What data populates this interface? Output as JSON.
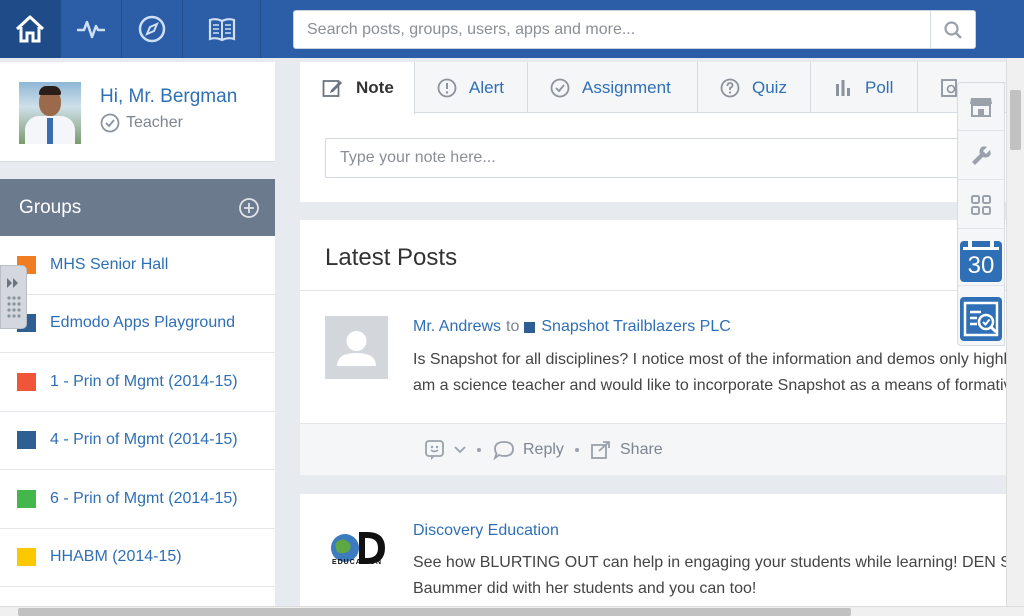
{
  "topbar": {
    "nav": [
      {
        "icon": "home-icon"
      },
      {
        "icon": "activity-icon"
      },
      {
        "icon": "compass-icon"
      },
      {
        "icon": "book-icon"
      }
    ],
    "search_placeholder": "Search posts, groups, users, apps and more...",
    "colors": {
      "bar": "#2b5ea6",
      "active": "#1f4b88"
    }
  },
  "profile": {
    "greeting": "Hi, Mr. Bergman",
    "role": "Teacher"
  },
  "groups": {
    "title": "Groups",
    "items": [
      {
        "label": "MHS Senior Hall",
        "color": "#f07d22"
      },
      {
        "label": "Edmodo Apps Playground",
        "color": "#2f5e92"
      },
      {
        "label": "1 - Prin of Mgmt (2014-15)",
        "color": "#f0553a"
      },
      {
        "label": "4 - Prin of Mgmt (2014-15)",
        "color": "#2f5e92"
      },
      {
        "label": "6 - Prin of Mgmt (2014-15)",
        "color": "#43b64c"
      },
      {
        "label": "HHABM (2014-15)",
        "color": "#fcc800"
      }
    ]
  },
  "composer": {
    "tabs": [
      {
        "label": "Note",
        "icon": "note-icon"
      },
      {
        "label": "Alert",
        "icon": "alert-icon"
      },
      {
        "label": "Assignment",
        "icon": "assignment-icon"
      },
      {
        "label": "Quiz",
        "icon": "quiz-icon"
      },
      {
        "label": "Poll",
        "icon": "poll-icon"
      }
    ],
    "note_placeholder": "Type your note here..."
  },
  "posts": {
    "title": "Latest Posts",
    "items": [
      {
        "author": "Mr. Andrews",
        "to": "to",
        "group": "Snapshot Trailblazers PLC",
        "body_lines": [
          "Is Snapshot for all disciplines? I notice most of the information and demos only highlight",
          "am a science teacher and would like to incorporate Snapshot as a means of formative"
        ],
        "actions": {
          "reply": "Reply",
          "share": "Share"
        }
      },
      {
        "author": "Discovery Education",
        "logo_text": "EDUCATION",
        "body_lines": [
          "See how BLURTING OUT can help in engaging your students while learning! DEN STA",
          "Baummer did with her students and you can too!"
        ]
      }
    ]
  },
  "right_tools": {
    "calendar_day": "30",
    "items": [
      "store-icon",
      "wrench-icon",
      "apps-grid-icon",
      "calendar-icon",
      "progress-icon"
    ]
  }
}
